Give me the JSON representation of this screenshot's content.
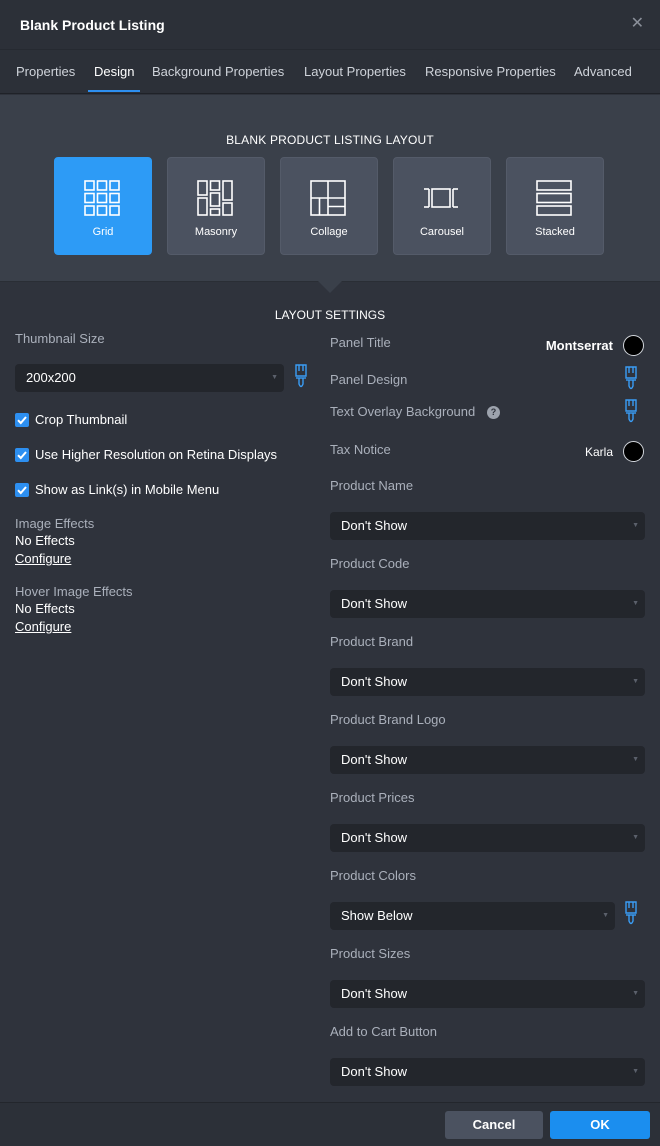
{
  "dialog": {
    "title": "Blank Product Listing",
    "close_icon": "close-icon"
  },
  "tabs": [
    {
      "label": "Properties"
    },
    {
      "label": "Design",
      "active": true
    },
    {
      "label": "Background Properties"
    },
    {
      "label": "Layout Properties"
    },
    {
      "label": "Responsive Properties"
    },
    {
      "label": "Advanced"
    }
  ],
  "layout": {
    "heading": "BLANK PRODUCT LISTING LAYOUT",
    "selected": "Grid",
    "options": [
      {
        "label": "Grid",
        "icon": "grid-layout-icon"
      },
      {
        "label": "Masonry",
        "icon": "masonry-layout-icon"
      },
      {
        "label": "Collage",
        "icon": "collage-layout-icon"
      },
      {
        "label": "Carousel",
        "icon": "carousel-layout-icon"
      },
      {
        "label": "Stacked",
        "icon": "stacked-layout-icon"
      }
    ]
  },
  "settings": {
    "heading": "LAYOUT SETTINGS",
    "left": {
      "thumbnail_size_label": "Thumbnail Size",
      "thumbnail_size_value": "200x200",
      "checkboxes": [
        {
          "label": "Crop Thumbnail",
          "checked": true
        },
        {
          "label": "Use Higher Resolution on Retina Displays",
          "checked": true
        },
        {
          "label": "Show as Link(s) in Mobile Menu",
          "checked": true
        }
      ],
      "image_effects": {
        "label": "Image Effects",
        "value": "No Effects",
        "link": "Configure"
      },
      "hover_image_effects": {
        "label": "Hover Image Effects",
        "value": "No Effects",
        "link": "Configure"
      }
    },
    "right": {
      "panel_title": {
        "label": "Panel Title",
        "font": "Montserrat",
        "color": "#000000"
      },
      "panel_design": {
        "label": "Panel Design"
      },
      "text_overlay": {
        "label": "Text Overlay Background",
        "help": "?"
      },
      "tax_notice": {
        "label": "Tax Notice",
        "font": "Karla",
        "color": "#000000"
      },
      "fields": [
        {
          "label": "Product Name",
          "value": "Don't Show"
        },
        {
          "label": "Product Code",
          "value": "Don't Show"
        },
        {
          "label": "Product Brand",
          "value": "Don't Show"
        },
        {
          "label": "Product Brand Logo",
          "value": "Don't Show"
        },
        {
          "label": "Product Prices",
          "value": "Don't Show"
        },
        {
          "label": "Product Colors",
          "value": "Show Below",
          "has_brush": true
        },
        {
          "label": "Product Sizes",
          "value": "Don't Show"
        },
        {
          "label": "Add to Cart Button",
          "value": "Don't Show"
        }
      ]
    }
  },
  "footer": {
    "cancel_label": "Cancel",
    "ok_label": "OK"
  },
  "colors": {
    "accent": "#2d9bf6",
    "background": "#2f333c",
    "panel": "#3a404a"
  }
}
